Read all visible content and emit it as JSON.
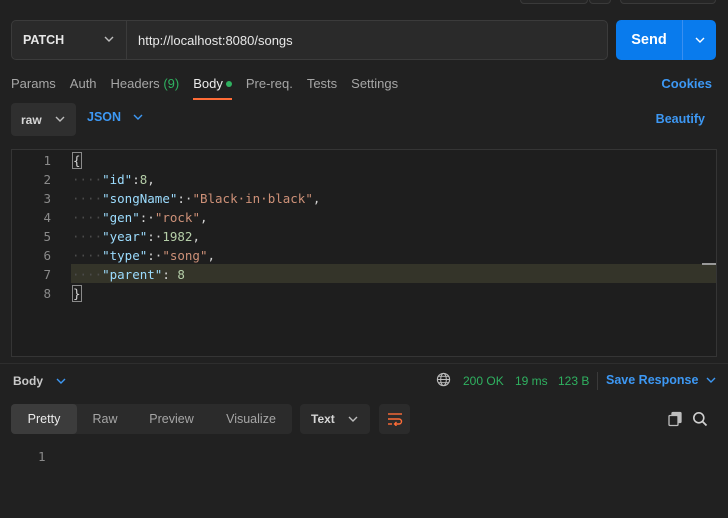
{
  "request": {
    "method": "PATCH",
    "url": "http://localhost:8080/songs",
    "send_label": "Send"
  },
  "tabs": [
    {
      "label": "Params"
    },
    {
      "label": "Auth"
    },
    {
      "label": "Headers",
      "count": "(9)"
    },
    {
      "label": "Body",
      "active": true
    },
    {
      "label": "Pre-req."
    },
    {
      "label": "Tests"
    },
    {
      "label": "Settings"
    }
  ],
  "cookies_label": "Cookies",
  "body_options": {
    "mode": "raw",
    "language": "JSON",
    "beautify_label": "Beautify"
  },
  "editor": {
    "line_numbers": [
      "1",
      "2",
      "3",
      "4",
      "5",
      "6",
      "7",
      "8"
    ],
    "highlighted_line": 7,
    "lines": [
      {
        "text": "{"
      },
      {
        "indent": "····",
        "key": "\"id\"",
        "sep": ":",
        "value": "8",
        "vtype": "num",
        "trail": ","
      },
      {
        "indent": "····",
        "key": "\"songName\"",
        "sep": ":·",
        "value": "\"Black·in·black\"",
        "vtype": "str",
        "trail": ","
      },
      {
        "indent": "····",
        "key": "\"gen\"",
        "sep": ":·",
        "value": "\"rock\"",
        "vtype": "str",
        "trail": ","
      },
      {
        "indent": "····",
        "key": "\"year\"",
        "sep": ":·",
        "value": "1982",
        "vtype": "num",
        "trail": ","
      },
      {
        "indent": "····",
        "key": "\"type\"",
        "sep": ":·",
        "value": "\"song\"",
        "vtype": "str",
        "trail": ","
      },
      {
        "indent": "····",
        "key": "\"parent\"",
        "sep": ": ",
        "value": "8",
        "vtype": "num",
        "trail": ""
      },
      {
        "text": "}"
      }
    ]
  },
  "response": {
    "title": "Body",
    "status": "200 OK",
    "time": "19 ms",
    "size": "123 B",
    "save_label": "Save Response",
    "view_tabs": [
      "Pretty",
      "Raw",
      "Preview",
      "Visualize"
    ],
    "active_view": "Pretty",
    "format": "Text",
    "line_numbers": [
      "1"
    ]
  },
  "colors": {
    "accent_blue": "#097bed",
    "link_blue": "#3d98f4",
    "success_green": "#2fb160",
    "active_tab_underline": "#ff6c37"
  }
}
